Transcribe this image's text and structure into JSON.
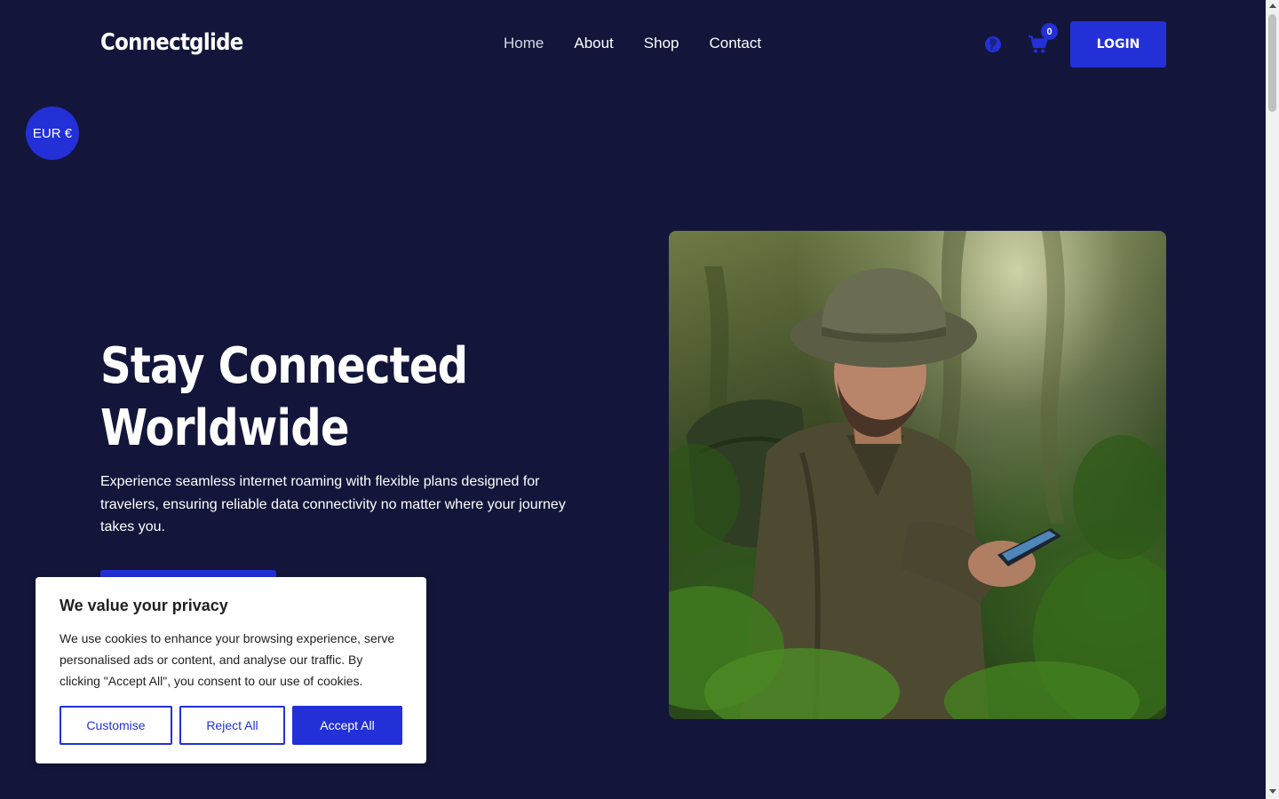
{
  "header": {
    "logo": "Connectglide",
    "nav": [
      {
        "label": "Home",
        "active": true
      },
      {
        "label": "About"
      },
      {
        "label": "Shop"
      },
      {
        "label": "Contact"
      }
    ],
    "cart_count": "0",
    "login_label": "LOGIN"
  },
  "currency": {
    "label": "EUR €"
  },
  "hero": {
    "title_line1": "Stay Connected",
    "title_line2": "Worldwide",
    "description": "Experience seamless internet roaming with flexible plans designed for travelers, ensuring reliable data connectivity no matter where your journey takes you."
  },
  "cookie": {
    "title": "We value your privacy",
    "text": "We use cookies to enhance your browsing experience, serve personalised ads or content, and analyse our traffic. By clicking \"Accept All\", you consent to our use of cookies.",
    "customise_label": "Customise",
    "reject_label": "Reject All",
    "accept_label": "Accept All"
  },
  "colors": {
    "background": "#13163a",
    "accent": "#2330d8",
    "text": "#ffffff"
  },
  "icons": [
    "globe-icon",
    "cart-icon"
  ]
}
